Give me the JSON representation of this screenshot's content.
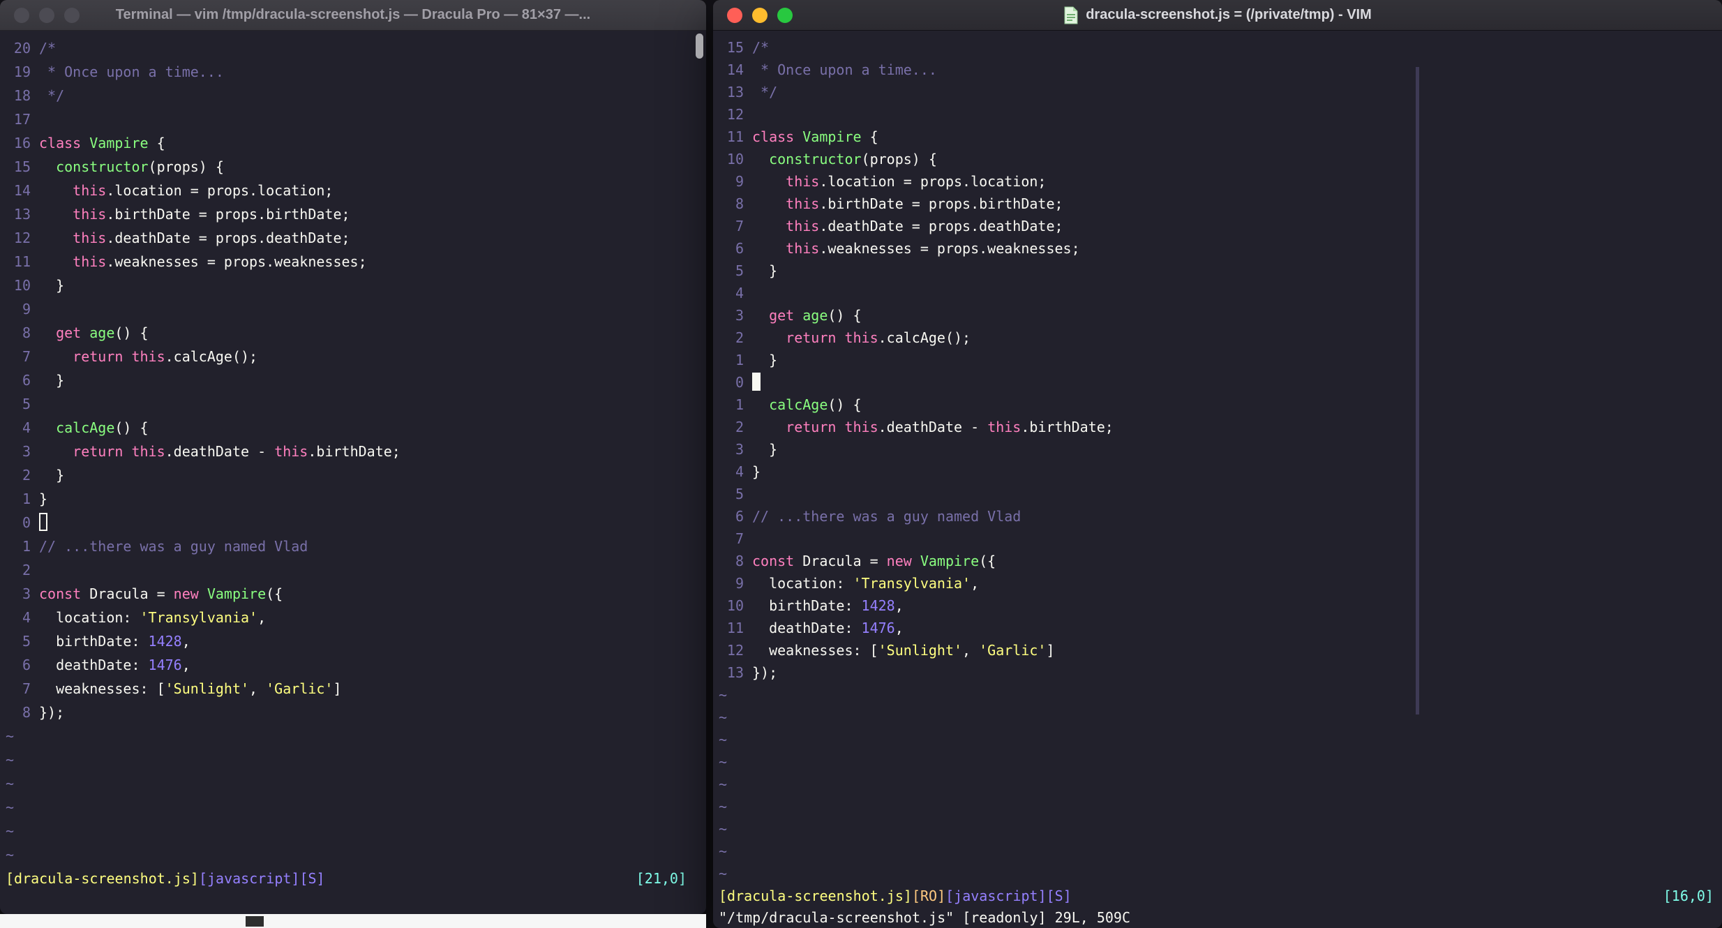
{
  "colors": {
    "bg": "#22212C",
    "fg": "#F8F8F2",
    "comment": "#7970A9",
    "pink": "#FF80BF",
    "green": "#8AFF80",
    "yellow": "#FFFF80",
    "purple": "#9580FF",
    "cyan": "#80FFEA",
    "orange": "#FFCA80",
    "line_number": "#7970A9"
  },
  "code_lines": [
    [
      [
        "comment",
        "/*"
      ]
    ],
    [
      [
        "comment",
        " * Once upon a time..."
      ]
    ],
    [
      [
        "comment",
        " */"
      ]
    ],
    [],
    [
      [
        "pink",
        "class"
      ],
      [
        "fg",
        " "
      ],
      [
        "green",
        "Vampire"
      ],
      [
        "fg",
        " {"
      ]
    ],
    [
      [
        "fg",
        "  "
      ],
      [
        "green",
        "constructor"
      ],
      [
        "fg",
        "(props) {"
      ]
    ],
    [
      [
        "fg",
        "    "
      ],
      [
        "pink",
        "this"
      ],
      [
        "fg",
        ".location = props.location;"
      ]
    ],
    [
      [
        "fg",
        "    "
      ],
      [
        "pink",
        "this"
      ],
      [
        "fg",
        ".birthDate = props.birthDate;"
      ]
    ],
    [
      [
        "fg",
        "    "
      ],
      [
        "pink",
        "this"
      ],
      [
        "fg",
        ".deathDate = props.deathDate;"
      ]
    ],
    [
      [
        "fg",
        "    "
      ],
      [
        "pink",
        "this"
      ],
      [
        "fg",
        ".weaknesses = props.weaknesses;"
      ]
    ],
    [
      [
        "fg",
        "  }"
      ]
    ],
    [],
    [
      [
        "fg",
        "  "
      ],
      [
        "pink",
        "get"
      ],
      [
        "fg",
        " "
      ],
      [
        "green",
        "age"
      ],
      [
        "fg",
        "() {"
      ]
    ],
    [
      [
        "fg",
        "    "
      ],
      [
        "pink",
        "return"
      ],
      [
        "fg",
        " "
      ],
      [
        "pink",
        "this"
      ],
      [
        "fg",
        ".calcAge();"
      ]
    ],
    [
      [
        "fg",
        "  }"
      ]
    ],
    [],
    [
      [
        "fg",
        "  "
      ],
      [
        "green",
        "calcAge"
      ],
      [
        "fg",
        "() {"
      ]
    ],
    [
      [
        "fg",
        "    "
      ],
      [
        "pink",
        "return"
      ],
      [
        "fg",
        " "
      ],
      [
        "pink",
        "this"
      ],
      [
        "fg",
        ".deathDate - "
      ],
      [
        "pink",
        "this"
      ],
      [
        "fg",
        ".birthDate;"
      ]
    ],
    [
      [
        "fg",
        "  }"
      ]
    ],
    [
      [
        "fg",
        "}"
      ]
    ],
    [],
    [
      [
        "comment",
        "// ...there was a guy named Vlad"
      ]
    ],
    [],
    [
      [
        "pink",
        "const"
      ],
      [
        "fg",
        " Dracula = "
      ],
      [
        "pink",
        "new"
      ],
      [
        "fg",
        " "
      ],
      [
        "green",
        "Vampire"
      ],
      [
        "fg",
        "({"
      ]
    ],
    [
      [
        "fg",
        "  location: "
      ],
      [
        "yellow",
        "'Transylvania'"
      ],
      [
        "fg",
        ","
      ]
    ],
    [
      [
        "fg",
        "  birthDate: "
      ],
      [
        "purple",
        "1428"
      ],
      [
        "fg",
        ","
      ]
    ],
    [
      [
        "fg",
        "  deathDate: "
      ],
      [
        "purple",
        "1476"
      ],
      [
        "fg",
        ","
      ]
    ],
    [
      [
        "fg",
        "  weaknesses: ["
      ],
      [
        "yellow",
        "'Sunlight'"
      ],
      [
        "fg",
        ", "
      ],
      [
        "yellow",
        "'Garlic'"
      ],
      [
        "fg",
        "]"
      ]
    ],
    [
      [
        "fg",
        "});"
      ]
    ]
  ],
  "left_window": {
    "title": "Terminal — vim /tmp/dracula-screenshot.js — Dracula Pro — 81×37 —...",
    "rel_numbers": [
      20,
      19,
      18,
      17,
      16,
      15,
      14,
      13,
      12,
      11,
      10,
      9,
      8,
      7,
      6,
      5,
      4,
      3,
      2,
      1,
      0,
      1,
      2,
      3,
      4,
      5,
      6,
      7,
      8
    ],
    "cursor_row": 20,
    "cursor_style": "hollow",
    "tilde_count": 6,
    "status_segments": [
      {
        "text": "[dracula-screenshot.js]",
        "color": "yellow"
      },
      {
        "text": "[javascript]",
        "color": "purple"
      },
      {
        "text": "[S]",
        "color": "purple"
      }
    ],
    "ruler": "[21,0]",
    "command_line": ""
  },
  "right_window": {
    "title": "dracula-screenshot.js = (/private/tmp) - VIM",
    "rel_numbers": [
      15,
      14,
      13,
      12,
      11,
      10,
      9,
      8,
      7,
      6,
      5,
      4,
      3,
      2,
      1,
      0,
      1,
      2,
      3,
      4,
      5,
      6,
      7,
      8,
      9,
      10,
      11,
      12,
      13
    ],
    "cursor_row": 15,
    "cursor_style": "block",
    "tilde_count": 9,
    "status_segments": [
      {
        "text": "[dracula-screenshot.js]",
        "color": "yellow"
      },
      {
        "text": "[RO]",
        "color": "orange"
      },
      {
        "text": "[javascript]",
        "color": "purple"
      },
      {
        "text": "[S]",
        "color": "purple"
      }
    ],
    "ruler": "[16,0]",
    "command_line": "\"/tmp/dracula-screenshot.js\" [readonly] 29L, 509C"
  }
}
